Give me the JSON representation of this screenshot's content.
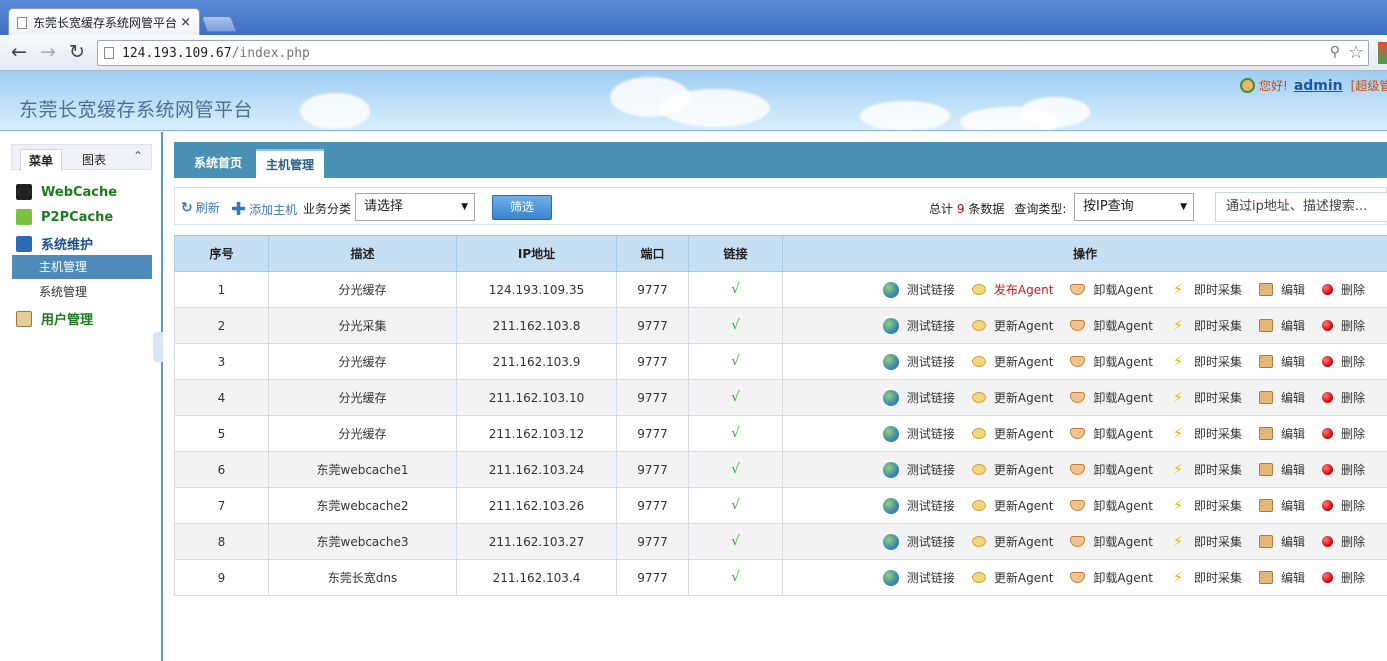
{
  "browser": {
    "tab_title": "东莞长宽缓存系统网管平台",
    "close_glyph": "×",
    "url_host": "124.193.109.67",
    "url_path": "/index.php"
  },
  "header": {
    "site_title": "东莞长宽缓存系统网管平台",
    "greeting": "您好!",
    "username": "admin",
    "role": "[超级管"
  },
  "sidebar": {
    "tabs": [
      "菜单",
      "图表"
    ],
    "collapse_glyph": "⌃",
    "groups": [
      {
        "label": "WebCache"
      },
      {
        "label": "P2PCache"
      },
      {
        "label": "系统维护"
      },
      {
        "label": "用户管理"
      }
    ],
    "subitems": [
      {
        "label": "主机管理",
        "active": true
      },
      {
        "label": "系统管理",
        "active": false
      }
    ]
  },
  "main_tabs": [
    "系统首页",
    "主机管理"
  ],
  "filter": {
    "refresh": "刷新",
    "add_host": "添加主机",
    "category_label": "业务分类",
    "category_value": "请选择",
    "submit": "筛选",
    "total_prefix": "总计",
    "total_count": "9",
    "total_suffix": "条数据",
    "query_type_label": "查询类型:",
    "query_type_value": "按IP查询",
    "search_placeholder": "通过ip地址、描述搜索..."
  },
  "table": {
    "headers": [
      "序号",
      "描述",
      "IP地址",
      "端口",
      "链接",
      "操作"
    ],
    "check_glyph": "√",
    "rows": [
      {
        "no": "1",
        "desc": "分光缓存",
        "ip": "124.193.109.35",
        "port": "9777",
        "agent_action": "发布Agent"
      },
      {
        "no": "2",
        "desc": "分光采集",
        "ip": "211.162.103.8",
        "port": "9777",
        "agent_action": "更新Agent"
      },
      {
        "no": "3",
        "desc": "分光缓存",
        "ip": "211.162.103.9",
        "port": "9777",
        "agent_action": "更新Agent"
      },
      {
        "no": "4",
        "desc": "分光缓存",
        "ip": "211.162.103.10",
        "port": "9777",
        "agent_action": "更新Agent"
      },
      {
        "no": "5",
        "desc": "分光缓存",
        "ip": "211.162.103.12",
        "port": "9777",
        "agent_action": "更新Agent"
      },
      {
        "no": "6",
        "desc": "东莞webcache1",
        "ip": "211.162.103.24",
        "port": "9777",
        "agent_action": "更新Agent"
      },
      {
        "no": "7",
        "desc": "东莞webcache2",
        "ip": "211.162.103.26",
        "port": "9777",
        "agent_action": "更新Agent"
      },
      {
        "no": "8",
        "desc": "东莞webcache3",
        "ip": "211.162.103.27",
        "port": "9777",
        "agent_action": "更新Agent"
      },
      {
        "no": "9",
        "desc": "东莞长宽dns",
        "ip": "211.162.103.4",
        "port": "9777",
        "agent_action": "更新Agent"
      }
    ],
    "ops": {
      "test": "测试链接",
      "unload": "卸载Agent",
      "collect": "即时采集",
      "edit": "编辑",
      "delete": "删除"
    }
  }
}
